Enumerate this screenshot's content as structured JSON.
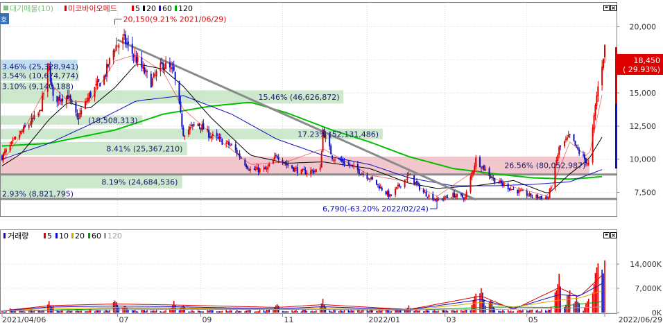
{
  "legend_price": [
    {
      "label": "대기매물(10)",
      "color": "#7fbf7f",
      "swatch": "#7fbf7f"
    },
    {
      "label": "미코바이오메드",
      "color": "#d01010",
      "swatch": "#e00000"
    },
    {
      "label": "5",
      "color": "#000000",
      "swatch": "#e00000"
    },
    {
      "label": "20",
      "color": "#000000",
      "swatch": "#000000"
    },
    {
      "label": "60",
      "color": "#000000",
      "swatch": "#1010c0"
    },
    {
      "label": "120",
      "color": "#000000",
      "swatch": "#00b000"
    }
  ],
  "legend_volume": [
    {
      "label": "거래량",
      "color": "#000000",
      "swatch": "#1010c0"
    },
    {
      "label": "5",
      "color": "#000000",
      "swatch": "#e00000"
    },
    {
      "label": "10",
      "color": "#000000",
      "swatch": "#1010c0"
    },
    {
      "label": "20",
      "color": "#000000",
      "swatch": "#e0a000"
    },
    {
      "label": "60",
      "color": "#000000",
      "swatch": "#00a000"
    },
    {
      "label": "120",
      "color": "#000000",
      "swatch": "#a0a0a0"
    }
  ],
  "side_tab": "호",
  "current_price": {
    "value": "18,450",
    "change": "( 29.93%)"
  },
  "max_annotation": "20,150(9.21% 2021/06/29)",
  "min_annotation": "6,790(-63.20% 2022/02/24)",
  "chart_data": [
    {
      "type": "candlestick",
      "name": "price",
      "ylim": [
        5700,
        21800
      ],
      "y_ticks": [
        7500,
        10000,
        12500,
        15000,
        17500,
        20000
      ],
      "y_tick_labels": [
        "7,500",
        "10,000",
        "12,500",
        "15,000",
        "17,500",
        "20,000"
      ],
      "x_ticks": [
        {
          "date": "2021/04/06",
          "label": "2021/04/06"
        },
        {
          "date": "2021/07/01",
          "label": "07"
        },
        {
          "date": "2021/09/01",
          "label": "09"
        },
        {
          "date": "2021/11/01",
          "label": "11"
        },
        {
          "date": "2022/01/03",
          "label": "2022/01"
        },
        {
          "date": "2022/03/02",
          "label": "03"
        },
        {
          "date": "2022/05/02",
          "label": "05"
        },
        {
          "date": "2022/06/29",
          "label": "2022/06/29"
        }
      ],
      "series_anchors": {
        "close": [
          [
            "2021/04/06",
            10200
          ],
          [
            "2021/04/20",
            12000
          ],
          [
            "2021/05/04",
            13500
          ],
          [
            "2021/05/11",
            17000
          ],
          [
            "2021/05/14",
            14500
          ],
          [
            "2021/05/25",
            14800
          ],
          [
            "2021/06/01",
            13000
          ],
          [
            "2021/06/10",
            14800
          ],
          [
            "2021/06/21",
            16200
          ],
          [
            "2021/06/29",
            18500
          ],
          [
            "2021/07/06",
            19000
          ],
          [
            "2021/07/15",
            17500
          ],
          [
            "2021/07/26",
            15800
          ],
          [
            "2021/08/04",
            17200
          ],
          [
            "2021/08/12",
            16500
          ],
          [
            "2021/08/19",
            12000
          ],
          [
            "2021/08/30",
            12700
          ],
          [
            "2021/09/08",
            11800
          ],
          [
            "2021/09/24",
            11000
          ],
          [
            "2021/10/08",
            9200
          ],
          [
            "2021/10/20",
            9200
          ],
          [
            "2021/10/28",
            10300
          ],
          [
            "2021/11/04",
            9600
          ],
          [
            "2021/11/15",
            9000
          ],
          [
            "2021/11/29",
            9200
          ],
          [
            "2021/12/01",
            12200
          ],
          [
            "2021/12/08",
            10200
          ],
          [
            "2021/12/20",
            9600
          ],
          [
            "2022/01/05",
            8600
          ],
          [
            "2022/01/20",
            7200
          ],
          [
            "2022/02/03",
            8800
          ],
          [
            "2022/02/14",
            7500
          ],
          [
            "2022/02/24",
            6900
          ],
          [
            "2022/03/08",
            7300
          ],
          [
            "2022/03/17",
            7100
          ],
          [
            "2022/03/25",
            10000
          ],
          [
            "2022/04/08",
            8400
          ],
          [
            "2022/04/22",
            7700
          ],
          [
            "2022/05/06",
            7200
          ],
          [
            "2022/05/18",
            7100
          ],
          [
            "2022/05/26",
            10800
          ],
          [
            "2022/06/03",
            11700
          ],
          [
            "2022/06/10",
            10500
          ],
          [
            "2022/06/17",
            9600
          ],
          [
            "2022/06/23",
            14800
          ],
          [
            "2022/06/29",
            18450
          ]
        ],
        "ma5": [
          [
            "2021/04/06",
            9800
          ],
          [
            "2021/04/20",
            11800
          ],
          [
            "2021/05/11",
            15800
          ],
          [
            "2021/05/25",
            14400
          ],
          [
            "2021/06/10",
            14300
          ],
          [
            "2021/06/29",
            17400
          ],
          [
            "2021/07/15",
            17900
          ],
          [
            "2021/08/04",
            16600
          ],
          [
            "2021/08/19",
            13800
          ],
          [
            "2021/09/08",
            12000
          ],
          [
            "2021/10/08",
            9600
          ],
          [
            "2021/11/04",
            9800
          ],
          [
            "2021/12/01",
            10800
          ],
          [
            "2022/01/05",
            8800
          ],
          [
            "2022/02/03",
            8300
          ],
          [
            "2022/02/24",
            7200
          ],
          [
            "2022/03/25",
            9200
          ],
          [
            "2022/04/22",
            7900
          ],
          [
            "2022/05/18",
            7200
          ],
          [
            "2022/06/03",
            11300
          ],
          [
            "2022/06/17",
            10100
          ],
          [
            "2022/06/29",
            15800
          ]
        ],
        "ma20": [
          [
            "2021/04/06",
            9500
          ],
          [
            "2021/04/20",
            10400
          ],
          [
            "2021/05/11",
            13000
          ],
          [
            "2021/05/25",
            14300
          ],
          [
            "2021/06/10",
            13800
          ],
          [
            "2021/06/29",
            15400
          ],
          [
            "2021/07/15",
            17200
          ],
          [
            "2021/08/04",
            16800
          ],
          [
            "2021/08/19",
            15500
          ],
          [
            "2021/09/08",
            13200
          ],
          [
            "2021/10/08",
            10300
          ],
          [
            "2021/11/04",
            9700
          ],
          [
            "2021/12/01",
            9800
          ],
          [
            "2022/01/05",
            9300
          ],
          [
            "2022/02/03",
            8200
          ],
          [
            "2022/02/24",
            7800
          ],
          [
            "2022/03/25",
            8000
          ],
          [
            "2022/04/22",
            8400
          ],
          [
            "2022/05/18",
            7400
          ],
          [
            "2022/06/03",
            8900
          ],
          [
            "2022/06/17",
            10000
          ],
          [
            "2022/06/29",
            12000
          ]
        ],
        "ma60": [
          [
            "2021/04/06",
            10000
          ],
          [
            "2021/05/11",
            11200
          ],
          [
            "2021/06/10",
            12600
          ],
          [
            "2021/07/15",
            14400
          ],
          [
            "2021/08/19",
            14800
          ],
          [
            "2021/09/24",
            13400
          ],
          [
            "2021/10/28",
            11500
          ],
          [
            "2021/12/01",
            10300
          ],
          [
            "2022/01/05",
            9600
          ],
          [
            "2022/02/03",
            8600
          ],
          [
            "2022/03/08",
            8000
          ],
          [
            "2022/04/08",
            8000
          ],
          [
            "2022/05/06",
            8100
          ],
          [
            "2022/06/03",
            8300
          ],
          [
            "2022/06/29",
            9300
          ]
        ],
        "ma120": [
          [
            "2021/04/06",
            11000
          ],
          [
            "2021/05/11",
            11200
          ],
          [
            "2021/06/29",
            12200
          ],
          [
            "2021/08/04",
            13400
          ],
          [
            "2021/09/08",
            14000
          ],
          [
            "2021/10/08",
            14300
          ],
          [
            "2021/11/04",
            13500
          ],
          [
            "2021/12/08",
            12200
          ],
          [
            "2022/01/05",
            11300
          ],
          [
            "2022/02/03",
            10200
          ],
          [
            "2022/03/08",
            9300
          ],
          [
            "2022/04/08",
            8900
          ],
          [
            "2022/05/06",
            8600
          ],
          [
            "2022/06/03",
            8500
          ],
          [
            "2022/06/29",
            8700
          ]
        ]
      },
      "volume_profile_bands": [
        {
          "price_low": 16500,
          "price_high": 17500,
          "pct": "3.46%",
          "volume": "(25,328,941)",
          "color": "#b8d8ee"
        },
        {
          "price_low": 15900,
          "price_high": 16700,
          "pct": "3.54%",
          "volume": "(10,674,774)",
          "color": "#c8e6c8"
        },
        {
          "price_low": 15200,
          "price_high": 15800,
          "pct": "3.10%",
          "volume": "(9,140,188)",
          "color": "#c8e6c8"
        },
        {
          "price_low": 14200,
          "price_high": 15200,
          "pct": "15.46%",
          "volume": "(46,626,872)",
          "color": "#c8e6c8"
        },
        {
          "price_low": 12600,
          "price_high": 13300,
          "pct": "",
          "volume": "(18,508,313)",
          "color": "#c8e6c8"
        },
        {
          "price_low": 11500,
          "price_high": 12300,
          "pct": "17.23%",
          "volume": "(52,131,486)",
          "color": "#c8e6c8"
        },
        {
          "price_low": 10300,
          "price_high": 11300,
          "pct": "8.41%",
          "volume": "(25,367,210)",
          "color": "#c8e6c8"
        },
        {
          "price_low": 8900,
          "price_high": 10200,
          "pct": "26.56%",
          "volume": "(80,052,987)",
          "color": "#f0c0c8"
        },
        {
          "price_low": 7800,
          "price_high": 8800,
          "pct": "8.19%",
          "volume": "(24,684,536)",
          "color": "#c8e6c8"
        },
        {
          "price_low": 7000,
          "price_high": 7800,
          "pct": "2.93%",
          "volume": "(8,821,795)",
          "color": "#c8e6c8"
        }
      ],
      "horizontal_lines": [
        8850,
        7000
      ],
      "trend_line": [
        [
          "2021/07/01",
          19000
        ],
        [
          "2022/03/25",
          6950
        ]
      ],
      "max_point": {
        "date": "2021/06/29",
        "price": 20150
      },
      "min_point": {
        "date": "2022/02/24",
        "price": 6790
      }
    },
    {
      "type": "bar",
      "name": "volume",
      "ylim": [
        0,
        19000
      ],
      "y_ticks": [
        0,
        7000,
        14000
      ],
      "y_tick_labels": [
        "0K",
        "7,000K",
        "14,000K"
      ],
      "unit": "thousand shares",
      "spikes": [
        [
          "2021/04/12",
          1500
        ],
        [
          "2021/05/11",
          3400
        ],
        [
          "2021/05/14",
          2200
        ],
        [
          "2021/06/29",
          4200
        ],
        [
          "2021/07/06",
          2500
        ],
        [
          "2021/08/12",
          3600
        ],
        [
          "2021/08/19",
          2600
        ],
        [
          "2021/10/28",
          3200
        ],
        [
          "2021/12/01",
          4200
        ],
        [
          "2022/01/27",
          1600
        ],
        [
          "2022/02/03",
          2200
        ],
        [
          "2022/03/25",
          6800
        ],
        [
          "2022/03/29",
          7900
        ],
        [
          "2022/04/05",
          4200
        ],
        [
          "2022/05/23",
          6500
        ],
        [
          "2022/05/26",
          13400
        ],
        [
          "2022/06/03",
          9200
        ],
        [
          "2022/06/08",
          5400
        ],
        [
          "2022/06/17",
          4800
        ],
        [
          "2022/06/21",
          8700
        ],
        [
          "2022/06/23",
          18500
        ],
        [
          "2022/06/27",
          13000
        ],
        [
          "2022/06/29",
          16200
        ]
      ],
      "series_anchors": {
        "ma5": [
          [
            "2021/04/06",
            500
          ],
          [
            "2021/05/11",
            2000
          ],
          [
            "2021/06/29",
            2500
          ],
          [
            "2021/08/12",
            2200
          ],
          [
            "2021/10/28",
            1500
          ],
          [
            "2021/12/01",
            2300
          ],
          [
            "2022/02/03",
            900
          ],
          [
            "2022/03/29",
            4800
          ],
          [
            "2022/04/22",
            900
          ],
          [
            "2022/05/26",
            7200
          ],
          [
            "2022/06/10",
            4500
          ],
          [
            "2022/06/29",
            11500
          ]
        ],
        "ma10": [
          [
            "2021/04/06",
            500
          ],
          [
            "2021/05/11",
            1600
          ],
          [
            "2021/06/29",
            1900
          ],
          [
            "2021/08/12",
            1700
          ],
          [
            "2021/10/28",
            1100
          ],
          [
            "2021/12/01",
            1700
          ],
          [
            "2022/02/03",
            800
          ],
          [
            "2022/03/29",
            3800
          ],
          [
            "2022/04/22",
            1200
          ],
          [
            "2022/05/26",
            5200
          ],
          [
            "2022/06/10",
            4800
          ],
          [
            "2022/06/29",
            8800
          ]
        ],
        "ma20": [
          [
            "2021/04/06",
            500
          ],
          [
            "2021/05/11",
            1200
          ],
          [
            "2021/06/29",
            1500
          ],
          [
            "2021/08/12",
            1400
          ],
          [
            "2021/10/28",
            900
          ],
          [
            "2021/12/01",
            1300
          ],
          [
            "2022/02/03",
            700
          ],
          [
            "2022/03/29",
            2900
          ],
          [
            "2022/04/22",
            1600
          ],
          [
            "2022/05/26",
            3600
          ],
          [
            "2022/06/10",
            4200
          ],
          [
            "2022/06/29",
            6500
          ]
        ],
        "ma60": [
          [
            "2021/04/06",
            500
          ],
          [
            "2021/06/29",
            1100
          ],
          [
            "2021/09/24",
            1000
          ],
          [
            "2021/12/01",
            900
          ],
          [
            "2022/02/03",
            700
          ],
          [
            "2022/04/08",
            1600
          ],
          [
            "2022/05/18",
            1500
          ],
          [
            "2022/06/29",
            3200
          ]
        ],
        "ma120": [
          [
            "2021/04/06",
            500
          ],
          [
            "2021/08/04",
            900
          ],
          [
            "2021/12/01",
            900
          ],
          [
            "2022/03/08",
            800
          ],
          [
            "2022/05/18",
            1100
          ],
          [
            "2022/06/29",
            1700
          ]
        ]
      }
    }
  ]
}
